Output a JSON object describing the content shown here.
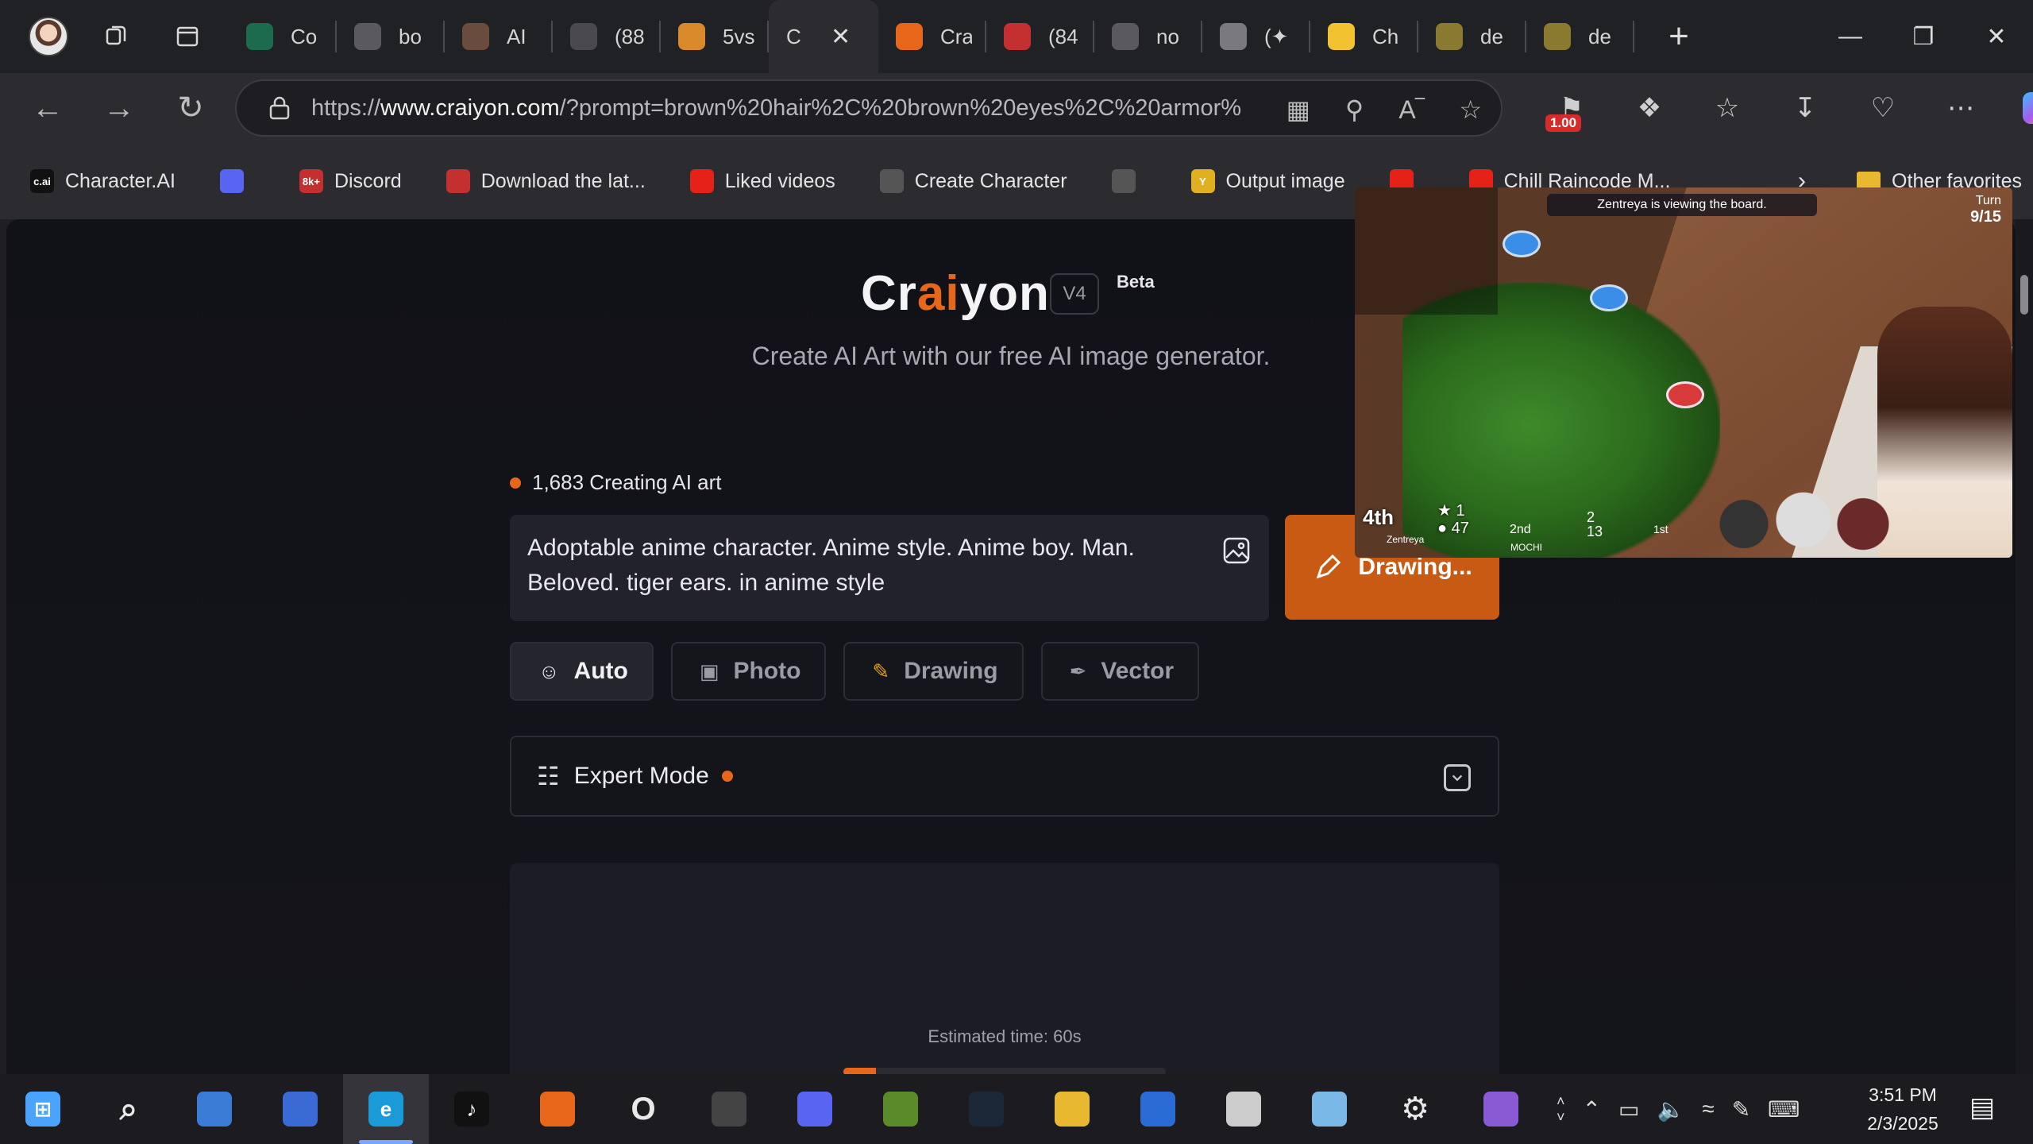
{
  "browser": {
    "tabs": [
      {
        "label": "Co",
        "color": "#1d6b4f"
      },
      {
        "label": "bo",
        "color": "#5a5a5e"
      },
      {
        "label": "AI",
        "color": "#6a4c3c"
      },
      {
        "label": "(88",
        "color": "#4a4a4e"
      },
      {
        "label": "5vs",
        "color": "#d88a2a"
      },
      {
        "label": "C",
        "color": "#2c2c30"
      },
      {
        "label": "Cra",
        "color": "#e8661a"
      },
      {
        "label": "(84",
        "color": "#c43030"
      },
      {
        "label": "no",
        "color": "#5a5a5e"
      },
      {
        "label": "(✦",
        "color": "#7a7a7e"
      },
      {
        "label": "Ch",
        "color": "#f2c230"
      },
      {
        "label": "de",
        "color": "#8a7a30"
      },
      {
        "label": "de",
        "color": "#8a7a30"
      }
    ],
    "active_tab_index": 5,
    "url_prefix": "https://",
    "url_host": "www.craiyon.com",
    "url_rest": "/?prompt=brown%20hair%2C%20brown%20eyes%2C%20armor%2...",
    "extension_badge": "1.00",
    "bookmarks": [
      {
        "label": "Character.AI",
        "icon": "c.ai",
        "color": "#111"
      },
      {
        "label": "",
        "icon": "discord-icon",
        "color": "#5865f2"
      },
      {
        "label": "Discord",
        "icon": "8k+",
        "color": "#c43030"
      },
      {
        "label": "Download the lat...",
        "icon": "store-icon",
        "color": "#c43030"
      },
      {
        "label": "Liked videos",
        "icon": "youtube-icon",
        "color": "#e62117"
      },
      {
        "label": "Create Character",
        "icon": "openai-icon",
        "color": "#555"
      },
      {
        "label": "",
        "icon": "page-icon",
        "color": "#555"
      },
      {
        "label": "Output image",
        "icon": "Y",
        "color": "#e0b020"
      },
      {
        "label": "",
        "icon": "youtube-icon",
        "color": "#e62117"
      },
      {
        "label": "Chill Raincode M...",
        "icon": "youtube-icon",
        "color": "#e62117"
      }
    ],
    "other_favorites": "Other favorites"
  },
  "page": {
    "logo_pre": "Cr",
    "logo_ai": "ai",
    "logo_post": "yon",
    "version": "V4",
    "beta": "Beta",
    "tagline": "Create AI Art with our free AI image generator.",
    "creating_count": "1,683 Creating AI art",
    "prompt_text": "Adoptable anime character. Anime style. Anime boy. Man. Beloved. tiger ears. in anime style",
    "draw_button": "Drawing...",
    "modes": [
      {
        "label": "Auto",
        "icon": "auto-icon",
        "selected": true
      },
      {
        "label": "Photo",
        "icon": "camera-icon",
        "selected": false
      },
      {
        "label": "Drawing",
        "icon": "pencil-icon",
        "selected": false
      },
      {
        "label": "Vector",
        "icon": "pen-nib-icon",
        "selected": false
      }
    ],
    "expert_mode": "Expert Mode",
    "estimated_time": "Estimated time: 60s",
    "progress_fraction": 0.1,
    "accent_color": "#e8661a"
  },
  "pip": {
    "banner": "Zentreya is viewing the board.",
    "turn_label": "Turn",
    "turn_value": "9/15",
    "rank": "4th",
    "stars": "1",
    "coins": "47",
    "player_name": "Zentreya",
    "p2_rank": "2nd",
    "p2_stars": "2",
    "p2_coins": "13",
    "p2_name": "MOCHI",
    "p3_rank": "1st"
  },
  "taskbar": {
    "apps": [
      {
        "name": "start-icon",
        "color": "#4aa3ff",
        "glyph": "⊞"
      },
      {
        "name": "search-icon",
        "color": "transparent",
        "glyph": "⌕"
      },
      {
        "name": "copilot-icon",
        "color": "#3a7bd5",
        "glyph": ""
      },
      {
        "name": "pinwheel-icon",
        "color": "#3a6bd5",
        "glyph": ""
      },
      {
        "name": "edge-icon",
        "color": "#1a9bd7",
        "glyph": "e",
        "active": true
      },
      {
        "name": "tiktok-icon",
        "color": "#111",
        "glyph": "♪"
      },
      {
        "name": "app-orange-icon",
        "color": "#e8661a",
        "glyph": ""
      },
      {
        "name": "opera-icon",
        "color": "transparent",
        "glyph": "O"
      },
      {
        "name": "paint-icon",
        "color": "#444",
        "glyph": ""
      },
      {
        "name": "discord-icon",
        "color": "#5865f2",
        "glyph": ""
      },
      {
        "name": "minecraft-icon",
        "color": "#5a8a2a",
        "glyph": ""
      },
      {
        "name": "steam-icon",
        "color": "#1b2838",
        "glyph": ""
      },
      {
        "name": "folder-icon",
        "color": "#e8b830",
        "glyph": ""
      },
      {
        "name": "store-icon",
        "color": "#2a6bd5",
        "glyph": ""
      },
      {
        "name": "roblox-icon",
        "color": "#ccc",
        "glyph": ""
      },
      {
        "name": "notes-icon",
        "color": "#7ab8e8",
        "glyph": ""
      },
      {
        "name": "settings-icon",
        "color": "transparent",
        "glyph": "⚙"
      },
      {
        "name": "anime-app-icon",
        "color": "#8a5ad5",
        "glyph": ""
      }
    ],
    "time": "3:51 PM",
    "date": "2/3/2025"
  }
}
